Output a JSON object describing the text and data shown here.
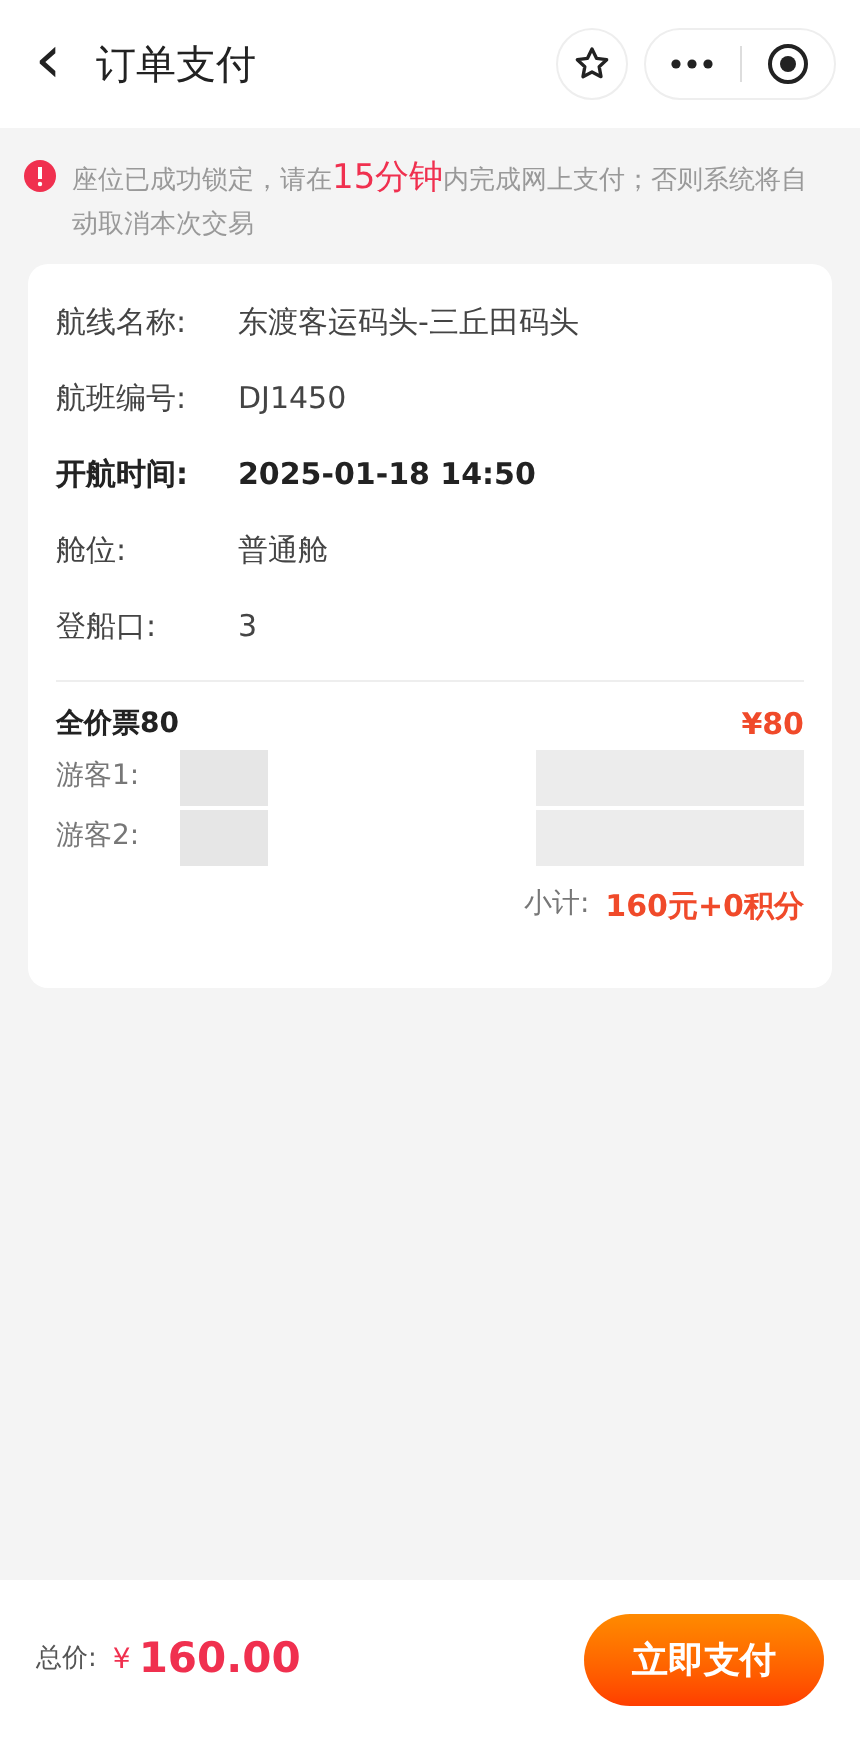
{
  "header": {
    "back_icon": "‹",
    "title": "订单支付"
  },
  "notice": {
    "before": "座位已成功锁定，请在",
    "highlight": "15分钟",
    "after": "内完成网上支付；否则系统将自动取消本次交易"
  },
  "details": [
    {
      "label": "航线名称:",
      "value": "东渡客运码头-三丘田码头",
      "emphasized": false
    },
    {
      "label": "航班编号:",
      "value": "DJ1450",
      "emphasized": false
    },
    {
      "label": "开航时间:",
      "value": "2025-01-18 14:50",
      "emphasized": true
    },
    {
      "label": "舱位:",
      "value": "普通舱",
      "emphasized": false
    },
    {
      "label": "登船口:",
      "value": "3",
      "emphasized": false
    }
  ],
  "ticket": {
    "name": "全价票80",
    "price": "¥80",
    "passengers": [
      "游客1:",
      "游客2:"
    ],
    "subtotal_label": "小计:",
    "subtotal": "160元+0积分"
  },
  "footer": {
    "total_label": "总价:",
    "currency": "¥",
    "total": "160.00",
    "pay_button": "立即支付"
  }
}
